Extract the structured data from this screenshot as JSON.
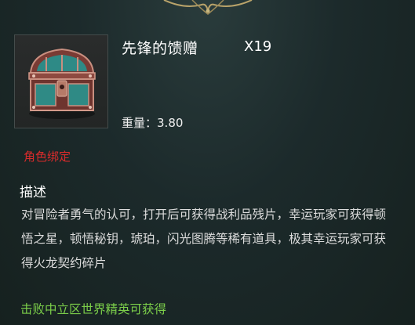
{
  "item": {
    "name": "先锋的馈赠",
    "count": "X19",
    "icon": "treasure-chest-icon",
    "weight_label": "重量：",
    "weight_value": "3.80"
  },
  "binding": {
    "text": "角色绑定",
    "color": "#d82b2b"
  },
  "description": {
    "title": "描述",
    "text": "对冒险者勇气的认可，打开后可获得战利品残片，幸运玩家可获得顿悟之星，顿悟秘钥，琥珀，闪光图腾等稀有道具，极其幸运玩家可获得火龙契约碎片"
  },
  "source": {
    "text": "击败中立区世界精英可获得",
    "color": "#7ccf4a"
  }
}
